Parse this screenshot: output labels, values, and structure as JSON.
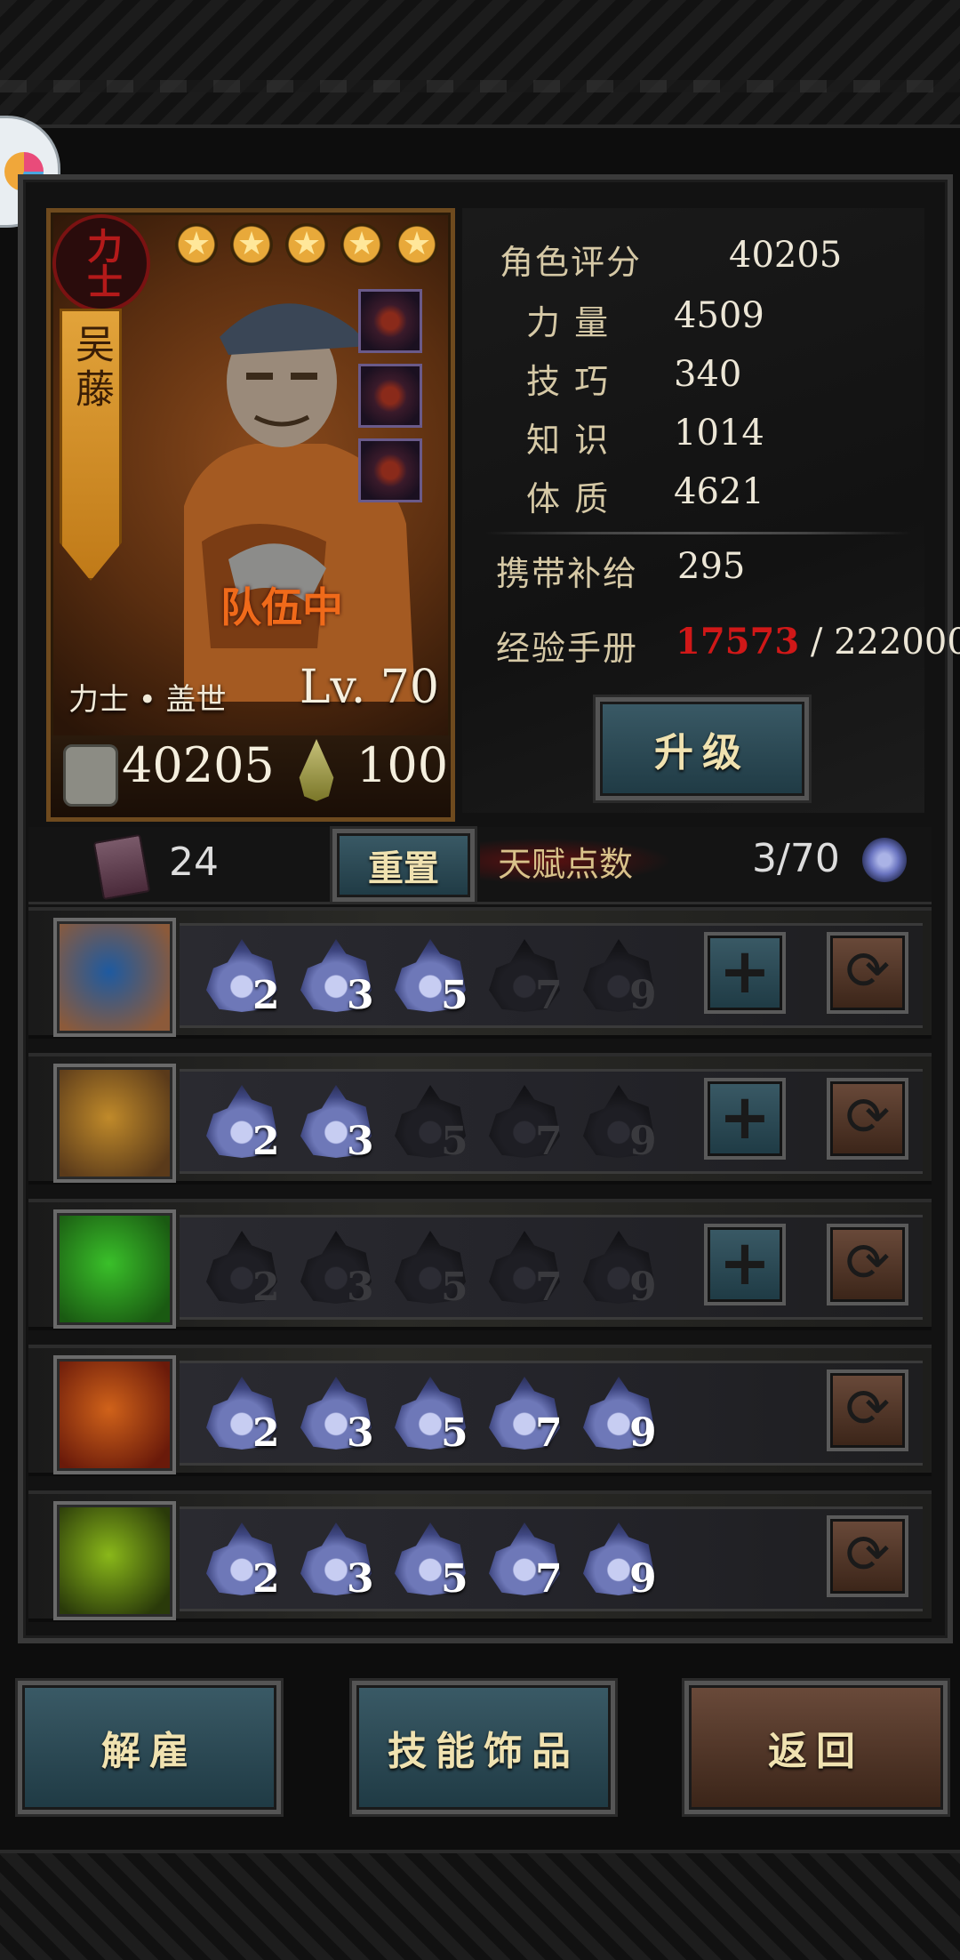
{
  "hero": {
    "class_seal": "力士",
    "name": "吴藤",
    "stars": [
      "★",
      "★",
      "★",
      "★",
      "★"
    ],
    "status": "队伍中",
    "class_line": "力士 • 盖世",
    "level": "Lv. 70",
    "power": "40205",
    "stamina": "100",
    "equipment": [
      "necklace-icon",
      "ring-icon",
      "amulet-icon"
    ]
  },
  "stats": {
    "rating_label": "角色评分",
    "rating_value": "40205",
    "rows": [
      {
        "label": "力 量",
        "value": "4509"
      },
      {
        "label": "技 巧",
        "value": "340"
      },
      {
        "label": "知 识",
        "value": "1014"
      },
      {
        "label": "体 质",
        "value": "4621"
      }
    ],
    "supply_label": "携带补给",
    "supply_value": "295",
    "exp_label": "经验手册",
    "exp_current": "17573",
    "exp_total": "/ 222000",
    "upgrade_label": "升级"
  },
  "talent": {
    "books": "24",
    "reset_label": "重置",
    "points_label": "天赋点数",
    "points": "3/70"
  },
  "skills": [
    {
      "icon": "flex-strength-icon",
      "levels": [
        "2",
        "3",
        "5",
        "7",
        "9"
      ],
      "active": 3,
      "has_plus": true
    },
    {
      "icon": "blade-strike-icon",
      "levels": [
        "2",
        "3",
        "5",
        "7",
        "9"
      ],
      "active": 2,
      "has_plus": true
    },
    {
      "icon": "green-fist-icon",
      "levels": [
        "2",
        "3",
        "5",
        "7",
        "9"
      ],
      "active": 0,
      "has_plus": true
    },
    {
      "icon": "fire-burst-icon",
      "levels": [
        "2",
        "3",
        "5",
        "7",
        "9"
      ],
      "active": 5,
      "has_plus": false
    },
    {
      "icon": "poison-shadow-icon",
      "levels": [
        "2",
        "3",
        "5",
        "7",
        "9"
      ],
      "active": 5,
      "has_plus": false
    }
  ],
  "bottom": {
    "dismiss": "解雇",
    "skill_items": "技能饰品",
    "back": "返回"
  }
}
